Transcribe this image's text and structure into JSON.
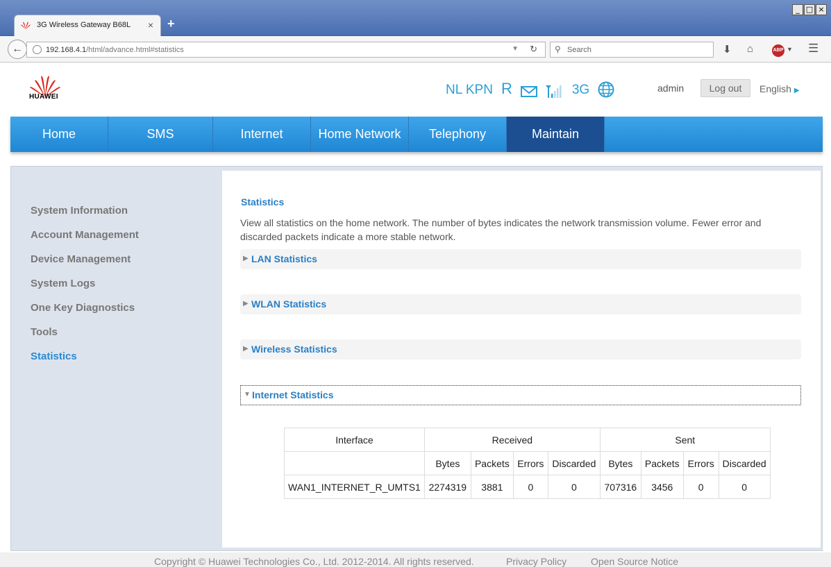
{
  "browser": {
    "tab_title": "3G Wireless Gateway B68L",
    "tab_close": "×",
    "new_tab": "+",
    "url_host": "192.168.4.1",
    "url_path": "/html/advance.html#statistics",
    "search_placeholder": "Search",
    "window_controls": [
      "_",
      "□",
      "×"
    ]
  },
  "header": {
    "logo_text": "HUAWEI",
    "provider": "NL KPN",
    "roaming": "R",
    "network_type": "3G",
    "user": "admin",
    "logout_label": "Log out",
    "language": "English"
  },
  "nav": {
    "items": [
      {
        "label": "Home",
        "width": 141
      },
      {
        "label": "SMS",
        "width": 151
      },
      {
        "label": "Internet",
        "width": 141
      },
      {
        "label": "Home Network",
        "width": 141
      },
      {
        "label": "Telephony",
        "width": 141
      },
      {
        "label": "Maintain",
        "width": 141,
        "active": true
      }
    ]
  },
  "sidebar": {
    "items": [
      {
        "label": "System Information"
      },
      {
        "label": "Account Management"
      },
      {
        "label": "Device Management"
      },
      {
        "label": "System Logs"
      },
      {
        "label": "One Key Diagnostics"
      },
      {
        "label": "Tools"
      },
      {
        "label": "Statistics",
        "active": true
      }
    ]
  },
  "content": {
    "title": "Statistics",
    "description": "View all statistics on the home network. The number of bytes indicates the network transmission volume. Fewer error and discarded packets indicate a more stable network.",
    "sections": [
      {
        "label": "LAN Statistics"
      },
      {
        "label": "WLAN Statistics"
      },
      {
        "label": "Wireless Statistics"
      },
      {
        "label": "Internet Statistics",
        "open": true
      }
    ]
  },
  "table": {
    "h_interface": "Interface",
    "h_received": "Received",
    "h_sent": "Sent",
    "sub_headers": [
      "Bytes",
      "Packets",
      "Errors",
      "Discarded",
      "Bytes",
      "Packets",
      "Errors",
      "Discarded"
    ],
    "row": {
      "interface": "WAN1_INTERNET_R_UMTS1",
      "values": [
        "2274319",
        "3881",
        "0",
        "0",
        "707316",
        "3456",
        "0",
        "0"
      ]
    }
  },
  "footer": {
    "copyright": "Copyright © Huawei Technologies Co., Ltd. 2012-2014. All rights reserved.",
    "privacy": "Privacy Policy",
    "open_source": "Open Source Notice"
  },
  "colors": {
    "accent": "#2a9fd8",
    "nav_blue": "#1f86d4",
    "nav_active": "#1b4f92",
    "huawei_red": "#e0261b"
  }
}
